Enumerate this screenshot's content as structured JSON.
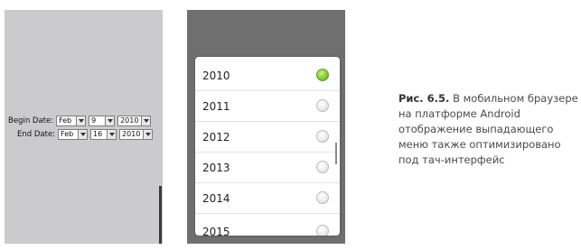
{
  "left_screen": {
    "begin_date": {
      "label": "Begin Date:",
      "month": "Feb",
      "day": "9",
      "year": "2010"
    },
    "end_date": {
      "label": "End Date:",
      "month": "Feb",
      "day": "16",
      "year": "2010"
    }
  },
  "year_picker": {
    "items": [
      {
        "label": "2010",
        "selected": true
      },
      {
        "label": "2011",
        "selected": false
      },
      {
        "label": "2012",
        "selected": false
      },
      {
        "label": "2013",
        "selected": false
      },
      {
        "label": "2014",
        "selected": false
      },
      {
        "label": "2015",
        "selected": false
      }
    ],
    "selected_color": "#7fcf2c"
  },
  "caption": {
    "number": "Рис. 6.5.",
    "text": "В мобильном браузере на платформе Android отображение выпадающего меню также оптимизировано под тач-интерфейс"
  }
}
